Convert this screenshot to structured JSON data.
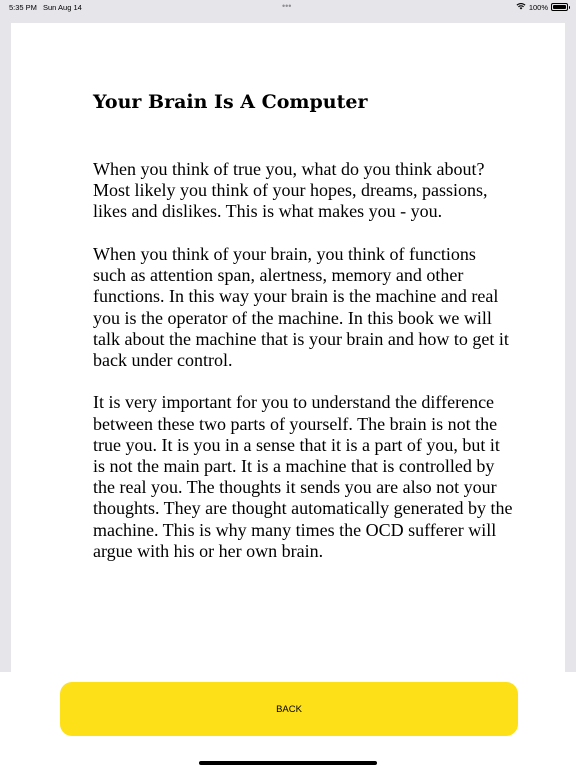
{
  "status_bar": {
    "time": "5:35 PM",
    "date": "Sun Aug 14",
    "multitask_dots": "•••",
    "battery_percent": "100%",
    "battery_level": 1.0
  },
  "page": {
    "title": "Your Brain Is A Computer",
    "paragraphs": [
      "When you think of true you, what do you think about? Most likely you think of your hopes, dreams, passions, likes and dislikes. This is what makes you - you.",
      "When you think of your brain, you think of functions such as attention span, alertness, memory and other functions. In this way your brain is the machine and real you is the operator of the machine. In this book we will talk about the machine that is your brain and how to get it back under control.",
      "It is very important for you to understand the difference between these two parts of yourself. The brain is not the true you. It is you in a sense that it is a part of you, but it is not the main part. It is a machine that is controlled by the real you. The thoughts it sends you are also not your thoughts. They are thought automatically generated by the machine. This is why many times the OCD sufferer will argue with his or her own brain."
    ]
  },
  "footer": {
    "back_label": "BACK"
  },
  "colors": {
    "button_yellow": "#fde018",
    "backdrop": "#e5e5ea"
  },
  "icons": [
    "wifi-icon",
    "battery-icon"
  ]
}
